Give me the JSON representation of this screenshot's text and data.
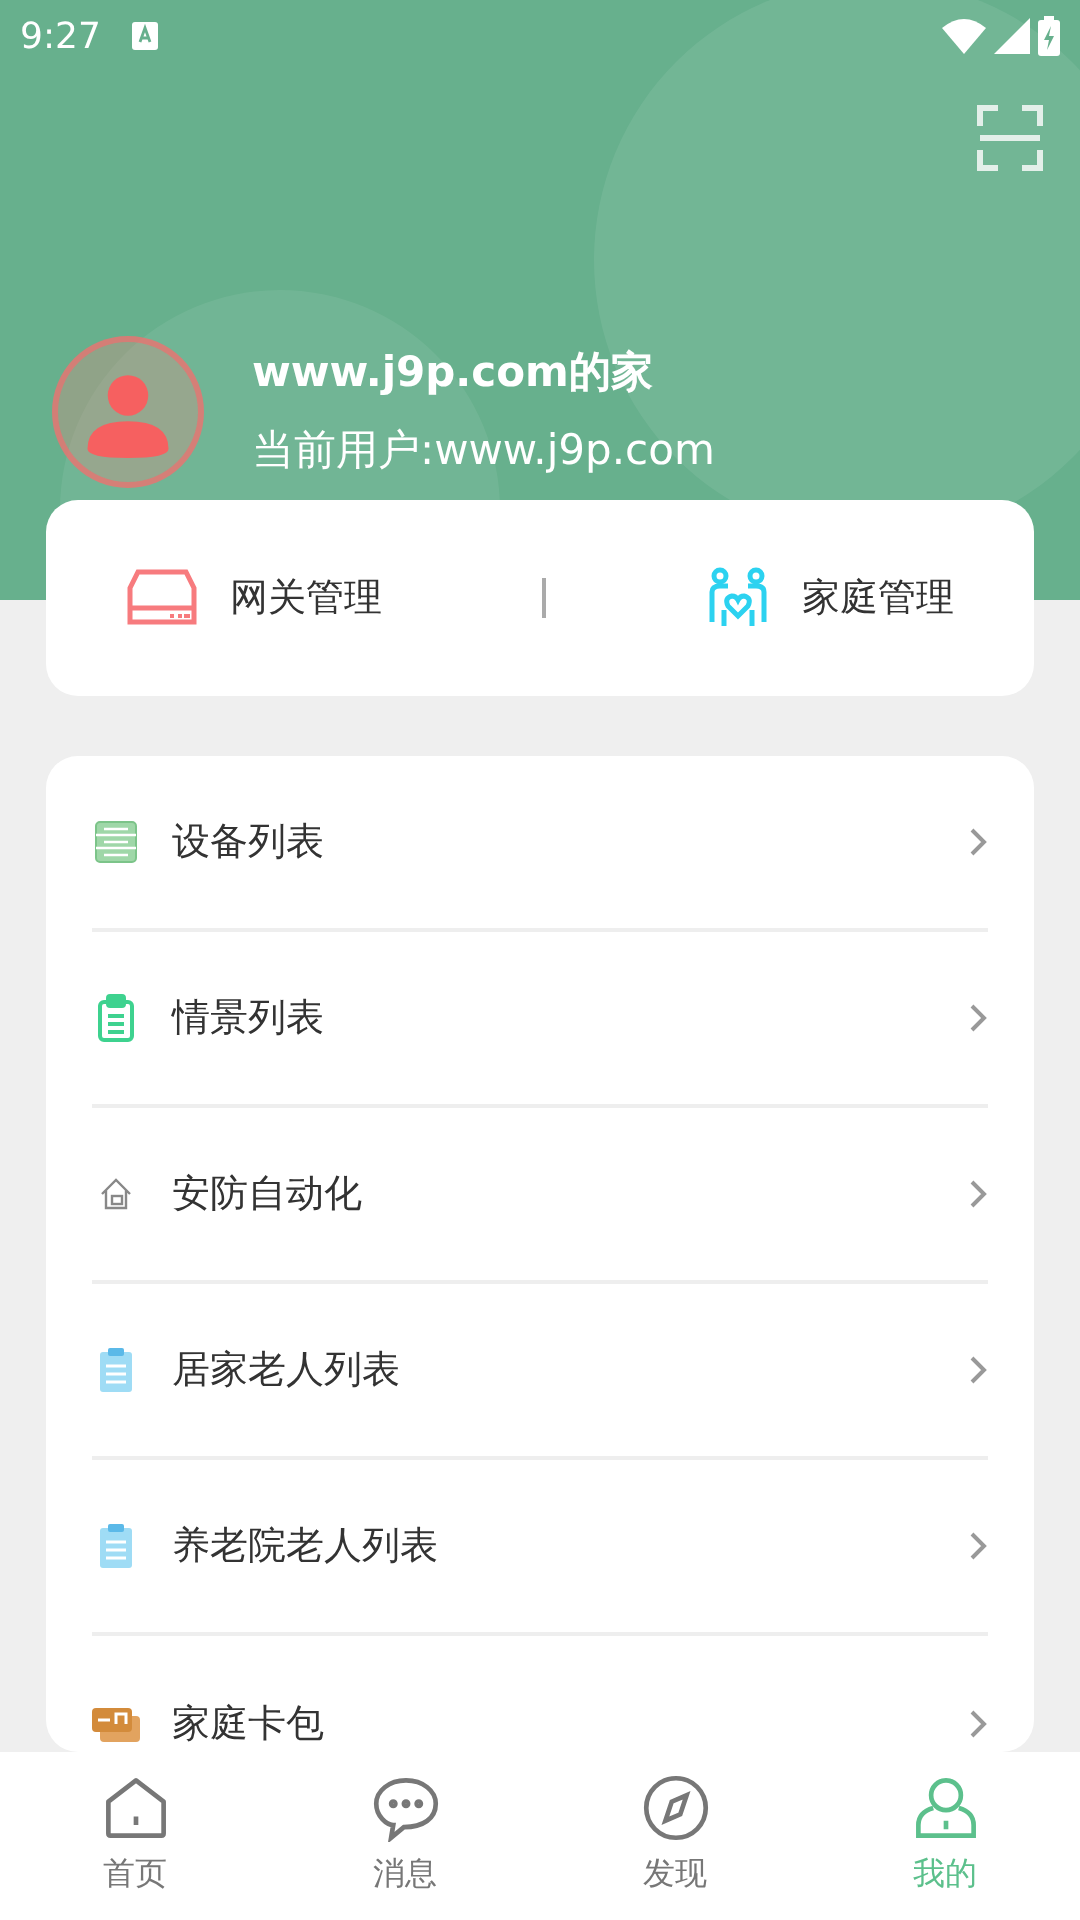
{
  "status_bar": {
    "time": "9:27"
  },
  "profile": {
    "home_name": "www.j9p.com的家",
    "current_user": "当前用户:www.j9p.com"
  },
  "quick_actions": [
    {
      "label": "网关管理"
    },
    {
      "label": "家庭管理"
    }
  ],
  "menu": [
    {
      "label": "设备列表"
    },
    {
      "label": "情景列表"
    },
    {
      "label": "安防自动化"
    },
    {
      "label": "居家老人列表"
    },
    {
      "label": "养老院老人列表"
    },
    {
      "label": "家庭卡包"
    }
  ],
  "tabs": [
    {
      "label": "首页",
      "selected": false
    },
    {
      "label": "消息",
      "selected": false
    },
    {
      "label": "发现",
      "selected": false
    },
    {
      "label": "我的",
      "selected": true
    }
  ]
}
